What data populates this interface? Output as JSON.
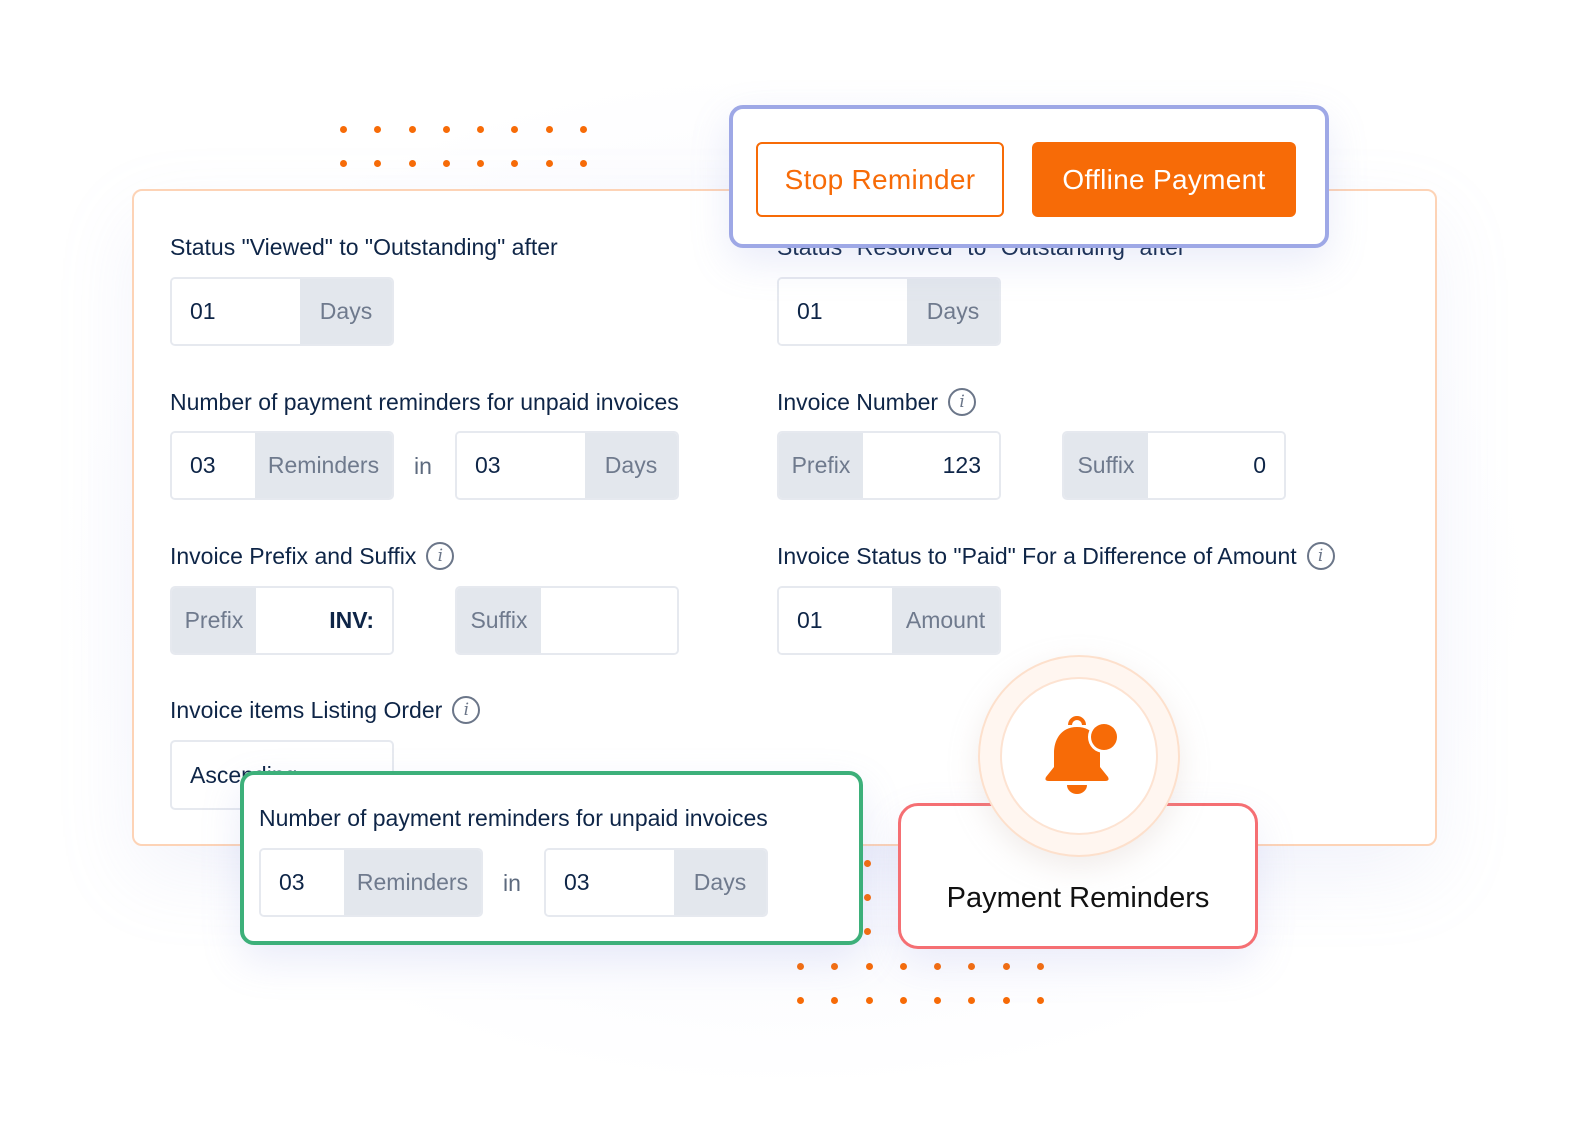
{
  "colors": {
    "accent": "#f76b07",
    "card_border": "#fdd3b6",
    "action_panel_border": "#9ea8e6",
    "highlight_border": "#3db07a",
    "reminder_border": "#f56f73",
    "addon_bg": "#e3e7ed",
    "text_dark": "#0e2547"
  },
  "actions": {
    "stop_reminder": "Stop Reminder",
    "offline_payment": "Offline Payment"
  },
  "settings": {
    "viewed_to_outstanding": {
      "label": "Status \"Viewed\" to \"Outstanding\" after",
      "value": "01",
      "unit": "Days"
    },
    "resolved_to_outstanding": {
      "label": "Status \"Resolved\" to \"Outstanding\" after",
      "value": "01",
      "unit": "Days"
    },
    "payment_reminders": {
      "label": "Number of payment reminders for unpaid invoices",
      "count": "03",
      "count_unit": "Reminders",
      "joiner": "in",
      "days": "03",
      "days_unit": "Days"
    },
    "invoice_number": {
      "label": "Invoice Number",
      "prefix_label": "Prefix",
      "prefix_value": "123",
      "suffix_label": "Suffix",
      "suffix_value": "0"
    },
    "prefix_suffix": {
      "label": "Invoice Prefix and Suffix",
      "prefix_label": "Prefix",
      "prefix_value": "INV:",
      "suffix_label": "Suffix",
      "suffix_value": ""
    },
    "paid_difference": {
      "label": "Invoice Status to \"Paid\" For a Difference of Amount",
      "value": "01",
      "unit": "Amount"
    },
    "listing_order": {
      "label": "Invoice items Listing Order",
      "selected": "Ascending"
    }
  },
  "highlight": {
    "label": "Number of payment reminders for unpaid invoices",
    "count": "03",
    "count_unit": "Reminders",
    "joiner": "in",
    "days": "03",
    "days_unit": "Days"
  },
  "feature": {
    "title": "Payment Reminders",
    "icon": "bell-notification-icon"
  }
}
